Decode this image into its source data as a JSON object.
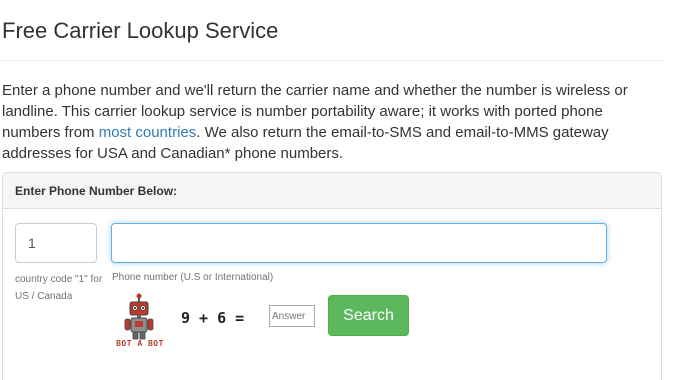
{
  "page": {
    "title": "Free Carrier Lookup Service",
    "intro_part1": "Enter a phone number and we'll return the carrier name and whether the number is wireless or landline. This carrier lookup service is number portability aware; it works with ported phone numbers from ",
    "intro_link": "most countries",
    "intro_part2": ". We also return the email-to-SMS and email-to-MMS gateway addresses for USA and Canadian* phone numbers."
  },
  "panel": {
    "heading": "Enter Phone Number Below:",
    "country_code_value": "1",
    "country_code_help": "country code \"1\" for US / Canada",
    "phone_placeholder": "",
    "phone_help": "Phone number (U.S or International)"
  },
  "captcha": {
    "robot_label": "BOT A BOT",
    "equation": "9 + 6 =",
    "answer_placeholder": "Answer"
  },
  "buttons": {
    "search_label": "Search"
  },
  "colors": {
    "link": "#337ab7",
    "search_button": "#5cb85c",
    "focus_border": "#66afe9",
    "robot_label": "#c0392b"
  }
}
